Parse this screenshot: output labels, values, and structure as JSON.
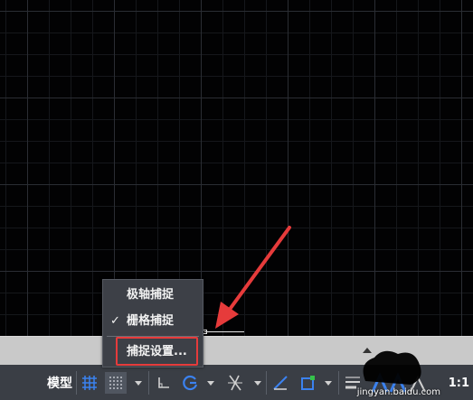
{
  "context_menu": {
    "items": [
      {
        "label": "极轴捕捉",
        "checked": false
      },
      {
        "label": "栅格捕捉",
        "checked": true
      },
      {
        "label": "捕捉设置..."
      }
    ],
    "check_glyph": "✓"
  },
  "status_bar": {
    "model_label": "模型",
    "scale_label": "1:1",
    "icons": [
      "grid-display-icon",
      "snap-mode-icon",
      "dropdown-icon",
      "ortho-icon",
      "polar-tracking-icon",
      "dropdown-icon",
      "object-snap-tracking-icon",
      "dropdown-icon",
      "dynamic-ucs-icon",
      "selection-cycling-icon",
      "dropdown-icon",
      "lineweight-icon",
      "annotation-icon"
    ]
  },
  "watermark": {
    "text": "jingyan.baidu.com"
  },
  "colors": {
    "canvas_bg": "#020203",
    "grid_major": "#2a2d33",
    "menu_bg": "#3d4047",
    "status_bg": "#3a3e45",
    "layout_bar": "#c9c9c9",
    "active_blue": "#3b82f0",
    "highlight_red": "#e63b3b"
  }
}
